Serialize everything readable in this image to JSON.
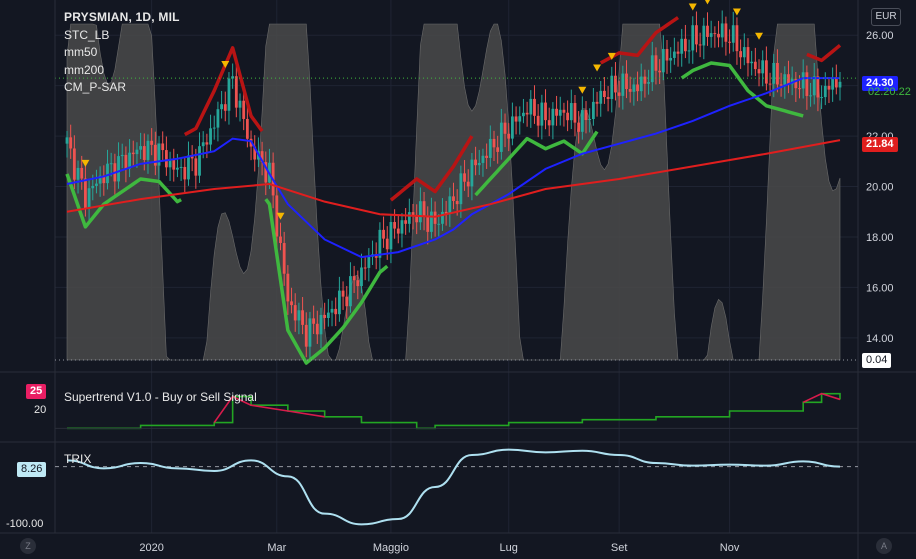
{
  "legend": {
    "title": "PRYSMIAN, 1D, MIL",
    "items": [
      "STC_LB",
      "mm50",
      "mm200",
      "CM_P-SAR"
    ]
  },
  "currency": "EUR",
  "price_labels": {
    "last": "24.30",
    "ma200": "21.84",
    "stc": "0.04",
    "overlay": "02.20.22",
    "supertrend_top": "25",
    "supertrend_20": "20",
    "trix_value": "8.26",
    "trix_low": "-100.00"
  },
  "panes": {
    "supertrend_title": "Supertrend V1.0 - Buy or Sell Signal",
    "trix_title": "TRIX"
  },
  "corner": {
    "left": "Z",
    "right": "A"
  },
  "colors": {
    "background": "#131722",
    "up": "#26a69a",
    "down": "#ef5350",
    "ma50": "#1e22ff",
    "ma200": "#e01e1e",
    "stc_fill": "#4a4a4a",
    "sar_up": "#3fb83f",
    "sar_down": "#b81414",
    "supertrend_up": "#23a623",
    "supertrend_down": "#d81b4c",
    "trix": "#aee0f0",
    "marker": "#f5b700"
  },
  "chart_data": [
    {
      "type": "line",
      "title": "PRYSMIAN, 1D, MIL",
      "x_ticks": [
        "2020",
        "Mar",
        "Maggio",
        "Lug",
        "Set",
        "Nov"
      ],
      "y_ticks": [
        "26.00",
        "24.00",
        "22.00",
        "20.00",
        "18.00",
        "16.00",
        "14.00"
      ],
      "ylim": [
        13.2,
        27.0
      ],
      "series": [
        {
          "name": "mm50",
          "x": [
            0,
            10,
            20,
            30,
            40,
            45,
            50,
            55,
            60,
            70,
            80,
            90,
            100,
            105,
            110,
            120,
            130,
            140,
            150,
            160,
            170,
            180,
            190,
            200,
            210
          ],
          "values": [
            20.1,
            20.4,
            20.9,
            21.1,
            21.4,
            21.9,
            21.8,
            20.5,
            19.3,
            17.9,
            17.2,
            17.4,
            17.9,
            18.3,
            18.9,
            19.7,
            20.7,
            21.3,
            21.7,
            22.1,
            22.6,
            23.2,
            23.7,
            24.3,
            24.3
          ]
        },
        {
          "name": "mm200",
          "x": [
            0,
            20,
            40,
            55,
            70,
            85,
            100,
            115,
            130,
            150,
            170,
            190,
            210
          ],
          "values": [
            19.0,
            19.5,
            19.9,
            20.1,
            19.4,
            18.9,
            18.8,
            19.3,
            19.9,
            20.3,
            20.8,
            21.3,
            21.84
          ]
        },
        {
          "name": "Price (close)",
          "x": [
            0,
            5,
            10,
            15,
            20,
            25,
            30,
            35,
            40,
            45,
            50,
            55,
            60,
            65,
            70,
            75,
            80,
            85,
            90,
            95,
            100,
            105,
            110,
            115,
            120,
            125,
            130,
            135,
            140,
            145,
            150,
            155,
            160,
            165,
            170,
            175,
            180,
            185,
            190,
            195,
            200,
            205,
            210
          ],
          "values": [
            21.7,
            19.6,
            20.5,
            21.0,
            21.5,
            21.4,
            20.6,
            21.0,
            22.5,
            24.2,
            21.5,
            20.5,
            15.5,
            14.2,
            14.8,
            15.6,
            16.6,
            17.8,
            18.4,
            19.0,
            18.5,
            19.5,
            20.7,
            21.5,
            22.3,
            23.1,
            22.7,
            23.0,
            22.5,
            23.6,
            24.0,
            23.9,
            24.8,
            25.3,
            25.8,
            26.1,
            26.0,
            25.0,
            24.4,
            24.2,
            24.0,
            23.7,
            24.3
          ]
        }
      ]
    },
    {
      "type": "line",
      "title": "Supertrend V1.0 - Buy or Sell Signal",
      "y_ticks": [
        "25",
        "20"
      ],
      "series": [
        {
          "name": "Supertrend V1.0 - Buy or Sell Signal",
          "x": [
            0,
            20,
            40,
            45,
            50,
            60,
            70,
            80,
            95,
            100,
            120,
            140,
            160,
            180,
            200,
            205,
            210
          ],
          "values": [
            20,
            20.5,
            21,
            25.5,
            24,
            23,
            22,
            21,
            20,
            20.5,
            21,
            21.5,
            22,
            23,
            24.5,
            26,
            25
          ]
        }
      ]
    },
    {
      "type": "line",
      "title": "TRIX",
      "y_ticks": [
        "8.26",
        "-100.00"
      ],
      "series": [
        {
          "name": "TRIX",
          "x": [
            0,
            10,
            20,
            30,
            40,
            50,
            60,
            70,
            80,
            90,
            100,
            110,
            120,
            130,
            140,
            150,
            160,
            170,
            180,
            190,
            200,
            210
          ],
          "values": [
            20,
            5,
            15,
            5,
            0,
            20,
            -10,
            -80,
            -100,
            -90,
            -30,
            30,
            40,
            35,
            38,
            30,
            15,
            10,
            12,
            10,
            18,
            8.26
          ]
        }
      ]
    }
  ]
}
